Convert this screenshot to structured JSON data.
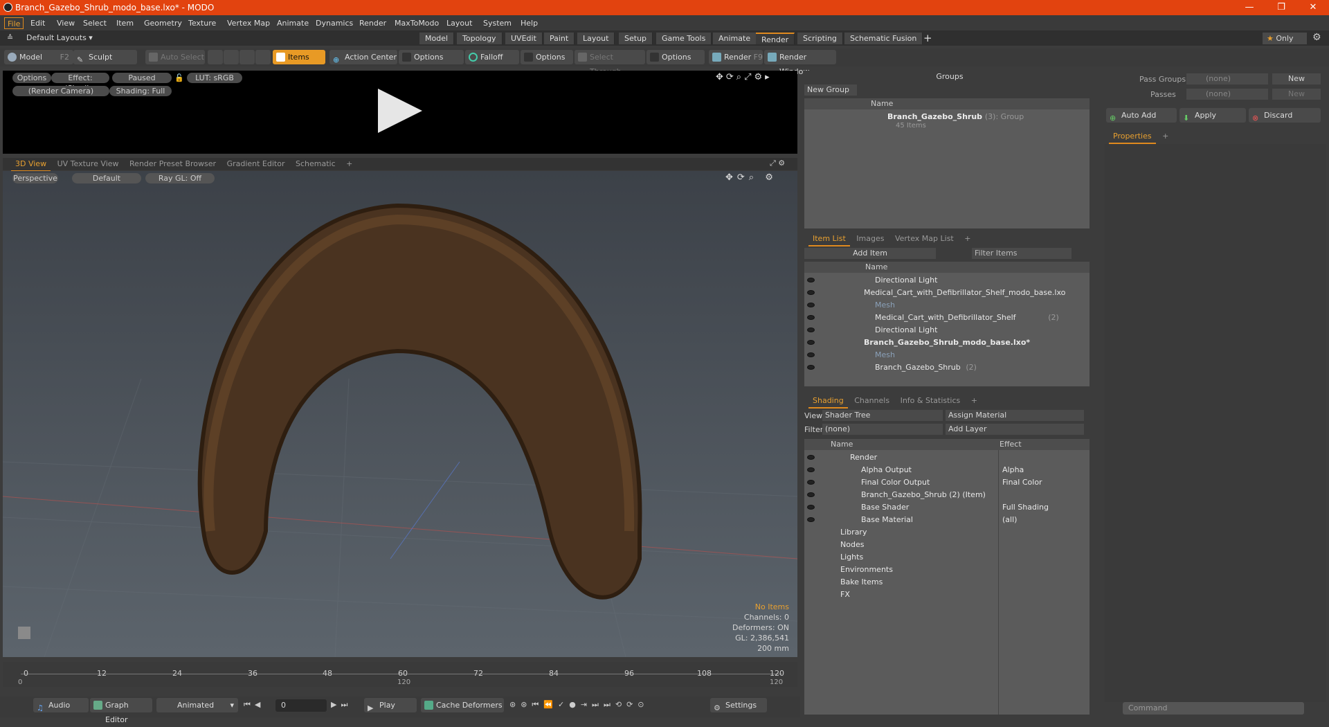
{
  "window": {
    "title": "Branch_Gazebo_Shrub_modo_base.lxo* - MODO"
  },
  "menu": [
    "File",
    "Edit",
    "View",
    "Select",
    "Item",
    "Geometry",
    "Texture",
    "Vertex Map",
    "Animate",
    "Dynamics",
    "Render",
    "MaxToModo",
    "Layout",
    "System",
    "Help"
  ],
  "layouts": {
    "default": "Default Layouts ▾",
    "tabs": [
      "Model",
      "Topology",
      "UVEdit",
      "Paint",
      "Layout",
      "Setup",
      "Game Tools",
      "Animate",
      "Render",
      "Scripting",
      "Schematic Fusion"
    ],
    "only": "Only"
  },
  "toolbar": {
    "model": "Model",
    "model_key": "F2",
    "sculpt": "Sculpt",
    "auto_select": "Auto Select",
    "items": "Items",
    "action_center": "Action Center",
    "options": "Options",
    "falloff": "Falloff",
    "select_through": "Select Through",
    "render": "Render",
    "render_key": "F9",
    "render_window": "Render Window"
  },
  "preview": {
    "options": "Options",
    "effect": "Effect: (Shadi...",
    "paused": "Paused",
    "lut": "LUT: sRGB",
    "camera": "(Render Camera)",
    "shading": "Shading: Full"
  },
  "viewtabs": [
    "3D View",
    "UV Texture View",
    "Render Preset Browser",
    "Gradient Editor",
    "Schematic"
  ],
  "viewport": {
    "perspective": "Perspective",
    "default": "Default",
    "raygl": "Ray GL: Off",
    "info": [
      "No Items",
      "Channels: 0",
      "Deformers: ON",
      "GL: 2,386,541",
      "200 mm"
    ]
  },
  "timeline": {
    "ticks": [
      "0",
      "12",
      "24",
      "36",
      "48",
      "60",
      "72",
      "84",
      "96",
      "108",
      "120"
    ],
    "sub_left": "0",
    "sub_mid": "120",
    "sub_right": "120"
  },
  "bottombar": {
    "audio": "Audio",
    "graph": "Graph Editor",
    "animated": "Animated",
    "frame": "0",
    "play": "Play",
    "cache": "Cache Deformers",
    "settings": "Settings"
  },
  "groups": {
    "title": "Groups",
    "new_group": "New Group",
    "name_col": "Name",
    "item": "Branch_Gazebo_Shrub",
    "count": "(3)",
    "kind": ": Group",
    "items_count": "45 Items"
  },
  "itemlist": {
    "tabs": [
      "Item List",
      "Images",
      "Vertex Map List"
    ],
    "add_item": "Add Item",
    "filter": "Filter Items",
    "name_col": "Name",
    "rows": [
      {
        "label": "Directional Light",
        "indent": 2
      },
      {
        "label": "Medical_Cart_with_Defibrillator_Shelf_modo_base.lxo",
        "indent": 0
      },
      {
        "label": "Mesh",
        "indent": 2,
        "dim": true
      },
      {
        "label": "Medical_Cart_with_Defibrillator_Shelf",
        "indent": 2,
        "suffix": "(2)"
      },
      {
        "label": "Directional Light",
        "indent": 2
      },
      {
        "label": "Branch_Gazebo_Shrub_modo_base.lxo*",
        "indent": 0,
        "bold": true
      },
      {
        "label": "Mesh",
        "indent": 2,
        "dim": true
      },
      {
        "label": "Branch_Gazebo_Shrub",
        "indent": 2,
        "suffix": "(2)"
      }
    ]
  },
  "shading": {
    "tabs": [
      "Shading",
      "Channels",
      "Info & Statistics"
    ],
    "view_label": "View",
    "view_value": "Shader Tree",
    "assign": "Assign Material",
    "filter_label": "Filter",
    "filter_value": "(none)",
    "add_layer": "Add Layer",
    "name_col": "Name",
    "effect_col": "Effect",
    "rows": [
      {
        "label": "Render",
        "effect": ""
      },
      {
        "label": "Alpha Output",
        "effect": "Alpha"
      },
      {
        "label": "Final Color Output",
        "effect": "Final Color"
      },
      {
        "label": "Branch_Gazebo_Shrub (2) (Item)",
        "effect": ""
      },
      {
        "label": "Base Shader",
        "effect": "Full Shading"
      },
      {
        "label": "Base Material",
        "effect": "(all)"
      },
      {
        "label": "Library",
        "effect": ""
      },
      {
        "label": "Nodes",
        "effect": ""
      },
      {
        "label": "Lights",
        "effect": ""
      },
      {
        "label": "Environments",
        "effect": ""
      },
      {
        "label": "Bake Items",
        "effect": ""
      },
      {
        "label": "FX",
        "effect": ""
      }
    ]
  },
  "passes": {
    "pass_groups": "Pass Groups",
    "passes": "Passes",
    "none": "(none)",
    "new": "New",
    "auto_add": "Auto Add",
    "apply": "Apply",
    "discard": "Discard",
    "properties": "Properties"
  },
  "command": {
    "placeholder": "Command"
  }
}
